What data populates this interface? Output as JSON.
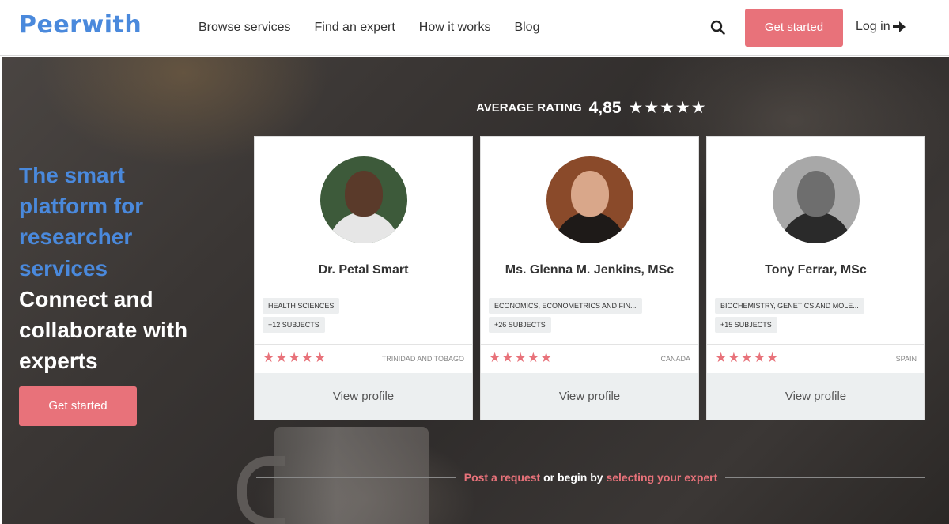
{
  "header": {
    "logo": "Peerwith",
    "nav": [
      "Browse services",
      "Find an expert",
      "How it works",
      "Blog"
    ],
    "search_icon": "search-icon",
    "cta_label": "Get started",
    "login_label": "Log in",
    "login_icon": "arrow-right-icon"
  },
  "hero": {
    "headline_blue": [
      "The smart",
      "platform for",
      "researcher",
      "services"
    ],
    "headline_white": [
      "Connect and",
      "collaborate with",
      "experts"
    ],
    "cta_label": "Get started",
    "rating_label": "AVERAGE RATING",
    "rating_value": "4,85",
    "rating_stars": "★★★★★"
  },
  "experts": [
    {
      "name": "Dr. Petal Smart",
      "subject": "HEALTH SCIENCES",
      "more_subjects": "+12 SUBJECTS",
      "stars": "★★★★★",
      "country": "TRINIDAD AND TOBAGO",
      "view_label": "View profile"
    },
    {
      "name": "Ms. Glenna M. Jenkins, MSc",
      "subject": "ECONOMICS, ECONOMETRICS AND FIN...",
      "more_subjects": "+26 SUBJECTS",
      "stars": "★★★★★",
      "country": "CANADA",
      "view_label": "View profile"
    },
    {
      "name": "Tony Ferrar, MSc",
      "subject": "BIOCHEMISTRY, GENETICS AND MOLE...",
      "more_subjects": "+15 SUBJECTS",
      "stars": "★★★★★",
      "country": "SPAIN",
      "view_label": "View profile"
    }
  ],
  "footer_prompt": {
    "link1": "Post a request",
    "middle": "or begin by",
    "link2": "selecting your expert"
  },
  "colors": {
    "brand_blue": "#4a89dc",
    "accent_pink": "#e8727a"
  }
}
